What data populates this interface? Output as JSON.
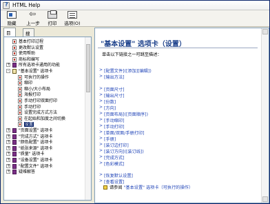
{
  "window": {
    "title": "HTML Help"
  },
  "toolbar": {
    "hide_label": "隐藏",
    "back_label": "上一步",
    "print_label": "打印",
    "options_label": "选项(O)"
  },
  "tabs": [
    {
      "label": "目录(C)",
      "active": true
    },
    {
      "label": "搜索(S)",
      "active": false
    }
  ],
  "tree": [
    {
      "label": "基本打印过程",
      "kind": "page",
      "indent": 1
    },
    {
      "label": "更改默认设置",
      "kind": "page",
      "indent": 1
    },
    {
      "label": "使用帮助",
      "kind": "page",
      "indent": 1
    },
    {
      "label": "商标和编写",
      "kind": "page",
      "indent": 1
    },
    {
      "label": "所有选项卡通用的功能",
      "kind": "book",
      "indent": 0,
      "expander": "+"
    },
    {
      "label": "\"基本设置\" 选项卡",
      "kind": "book-open",
      "indent": 0,
      "expander": "-"
    },
    {
      "label": "可执行的操作",
      "kind": "page",
      "indent": 2
    },
    {
      "label": "缩印",
      "kind": "page",
      "indent": 2
    },
    {
      "label": "缩小/大小布局",
      "kind": "page",
      "indent": 2
    },
    {
      "label": "海报打印",
      "kind": "page",
      "indent": 2
    },
    {
      "label": "手动打印双面打印",
      "kind": "page",
      "indent": 2
    },
    {
      "label": "手动打印",
      "kind": "page",
      "indent": 2
    },
    {
      "label": "设置完成方式方法",
      "kind": "page",
      "indent": 2
    },
    {
      "label": "在起始和加度之间切换",
      "kind": "page",
      "indent": 2
    },
    {
      "label": "设置",
      "kind": "page",
      "indent": 2,
      "selected": true
    },
    {
      "label": "\"页面设置\" 选项卡",
      "kind": "book",
      "indent": 0,
      "expander": "+"
    },
    {
      "label": "\"完成方式\" 选项卡",
      "kind": "book",
      "indent": 0,
      "expander": "+"
    },
    {
      "label": "\"颜色配置\" 选项卡",
      "kind": "book",
      "indent": 0,
      "expander": "+"
    },
    {
      "label": "\"纸张来源\" 选项卡",
      "kind": "book",
      "indent": 0,
      "expander": "+"
    },
    {
      "label": "\"质量\" 选项卡",
      "kind": "book",
      "indent": 0,
      "expander": "+"
    },
    {
      "label": "\"设备设置\" 选项卡",
      "kind": "book",
      "indent": 0,
      "expander": "+"
    },
    {
      "label": "\"配置文件\" 选项卡",
      "kind": "book",
      "indent": 0,
      "expander": "+"
    },
    {
      "label": "疑难解答",
      "kind": "book",
      "indent": 0,
      "expander": "+"
    }
  ],
  "topic": {
    "title": "\"基本设置\" 选项卡（设置）",
    "intro": "单击以下链接之一可跳至描述：",
    "links": [
      "[配置文件]([添加][编辑])",
      "[输出方法]",
      "[页面尺寸]",
      "[输出尺寸]",
      "[份数]",
      "[方向]",
      "[页面布局]([页面顺序])",
      "[手动缩印]",
      "[手动打印]",
      "[单面/双面/手册打印]",
      "[手册]",
      "[装订边打印]",
      "[装订方向]([装订线])",
      "[完成方式]",
      "[色彩模式]",
      "[恢复默认设置]",
      "[查看设置]"
    ],
    "see_also_prefix": "请参阅",
    "see_also_link": "\"基本设置\" 选项卡（可执行的操作）"
  }
}
